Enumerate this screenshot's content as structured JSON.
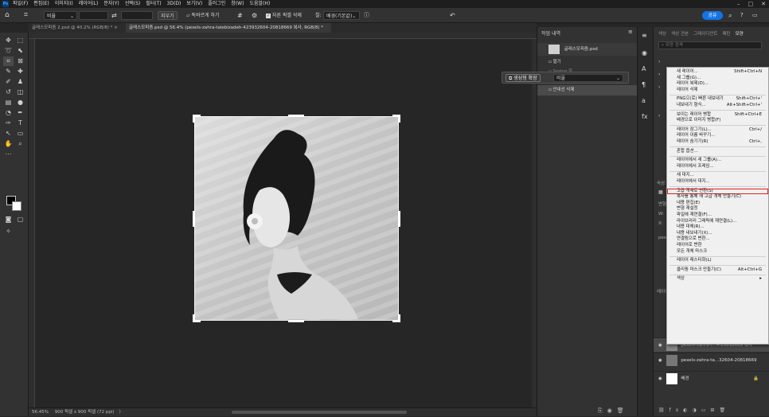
{
  "app": {
    "logo": "Ps"
  },
  "menubar": {
    "items": [
      "파일(F)",
      "편집(E)",
      "이미지(I)",
      "레이어(L)",
      "문자(Y)",
      "선택(S)",
      "필터(T)",
      "3D(D)",
      "보기(V)",
      "플러그인",
      "창(W)",
      "도움말(H)"
    ],
    "window_controls": [
      "–",
      "□",
      "✕"
    ]
  },
  "options": {
    "style_label": "비율",
    "clear_button": "지우기",
    "straighten_label": "똑바르게 하기",
    "delete_cropped_label": "자른 픽셀 삭제",
    "fill_label": "칠:",
    "fill_value": "배경(기본값)",
    "share_button": "공유",
    "icons": [
      "home-icon",
      "crop-icon",
      "swap-icon",
      "grid-icon",
      "gear-icon",
      "info-icon",
      "undo-icon",
      "search-icon",
      "help-icon",
      "workspace-icon"
    ]
  },
  "tabs": [
    {
      "label": "글래스모피즘 2.psd @ 40.2% (RGB/8) *",
      "close": "×"
    },
    {
      "label": "글래스모피즘.psd @ 56.4% (pexels-zahra-talebizadeh-423932604-20818669 복사, RGB/8) *",
      "close": "×"
    }
  ],
  "status": {
    "zoom": "56.45%",
    "doc_size": "900 픽셀 x 900 픽셀 (72 ppi)",
    "arrow": "〉"
  },
  "history": {
    "panel_title": "작업 내역",
    "snapshot": "글래스모피즘.psd",
    "items": [
      "열기",
      "Spring 칭"
    ],
    "generative_expand": "생성형 확장",
    "generative_value": "비율",
    "selected_item": "안내선 삭제"
  },
  "right_panel": {
    "tabs": [
      "색상",
      "색상 견본",
      "그레이디언트",
      "패턴",
      "모양"
    ],
    "search_placeholder": "모양 검색",
    "properties_title": "속성",
    "layers_title": "레이어",
    "layers": [
      {
        "name": "pexels-zahra-t...4-20818669 복사"
      },
      {
        "name": "pexels-zahra-ta...32604-20818669"
      },
      {
        "name": "배경"
      }
    ],
    "side_labels": [
      "변형",
      "W:",
      "X:",
      "pexe"
    ]
  },
  "context_menu": {
    "items": [
      {
        "label": "새 레이어...",
        "shortcut": "Shift+Ctrl+N"
      },
      {
        "label": "새 그룹(G)...",
        "shortcut": ""
      },
      {
        "label": "레이어 복제(D)...",
        "shortcut": ""
      },
      {
        "label": "레이어 삭제",
        "shortcut": ""
      },
      {
        "sep": true
      },
      {
        "label": "PNG으(로) 빠른 내보내기",
        "shortcut": "Shift+Ctrl+'"
      },
      {
        "label": "내보내기 형식...",
        "shortcut": "Alt+Shift+Ctrl+'"
      },
      {
        "sep": true
      },
      {
        "label": "보이는 레이어 병합",
        "shortcut": "Shift+Ctrl+E"
      },
      {
        "label": "배경으로 이미지 병합(F)",
        "shortcut": ""
      },
      {
        "sep": true
      },
      {
        "label": "레이어 잠그기(L)...",
        "shortcut": "Ctrl+/"
      },
      {
        "label": "레이어 이름 바꾸기...",
        "shortcut": ""
      },
      {
        "label": "레이어 숨기기(R)",
        "shortcut": "Ctrl+,"
      },
      {
        "sep": true
      },
      {
        "label": "혼합 옵션...",
        "shortcut": ""
      },
      {
        "sep": true
      },
      {
        "label": "레이어에서 새 그룹(A)...",
        "shortcut": ""
      },
      {
        "label": "레이어에서 프레임...",
        "shortcut": ""
      },
      {
        "sep": true
      },
      {
        "label": "새 대지...",
        "shortcut": ""
      },
      {
        "label": "레이어에서 대지...",
        "shortcut": ""
      },
      {
        "sep": true
      },
      {
        "label": "고급 개체로 변환(S)",
        "shortcut": "",
        "highlight": true
      },
      {
        "label": "복사를 통해 새 고급 개체 만들기(C)",
        "shortcut": ""
      },
      {
        "label": "내용 편집(E)",
        "shortcut": ""
      },
      {
        "label": "변형 재설정",
        "shortcut": ""
      },
      {
        "label": "파일에 재연결(F)...",
        "shortcut": ""
      },
      {
        "label": "라이브러리 그래픽에 재연결(L)...",
        "shortcut": ""
      },
      {
        "label": "내용 대체(R)...",
        "shortcut": ""
      },
      {
        "label": "내용 내보내기(X)...",
        "shortcut": ""
      },
      {
        "label": "연결됨으로 변환...",
        "shortcut": ""
      },
      {
        "label": "레이어로 변환",
        "shortcut": ""
      },
      {
        "label": "모든 개체 마스크",
        "shortcut": ""
      },
      {
        "sep": true
      },
      {
        "label": "레이어 래스터화(L)",
        "shortcut": ""
      },
      {
        "sep": true
      },
      {
        "label": "클리핑 마스크 만들기(C)",
        "shortcut": "Alt+Ctrl+G"
      },
      {
        "sep": true
      },
      {
        "label": "색상",
        "shortcut": "▸"
      }
    ]
  },
  "colors": {
    "highlight_box": "#e02020",
    "accent": "#1473e6"
  }
}
